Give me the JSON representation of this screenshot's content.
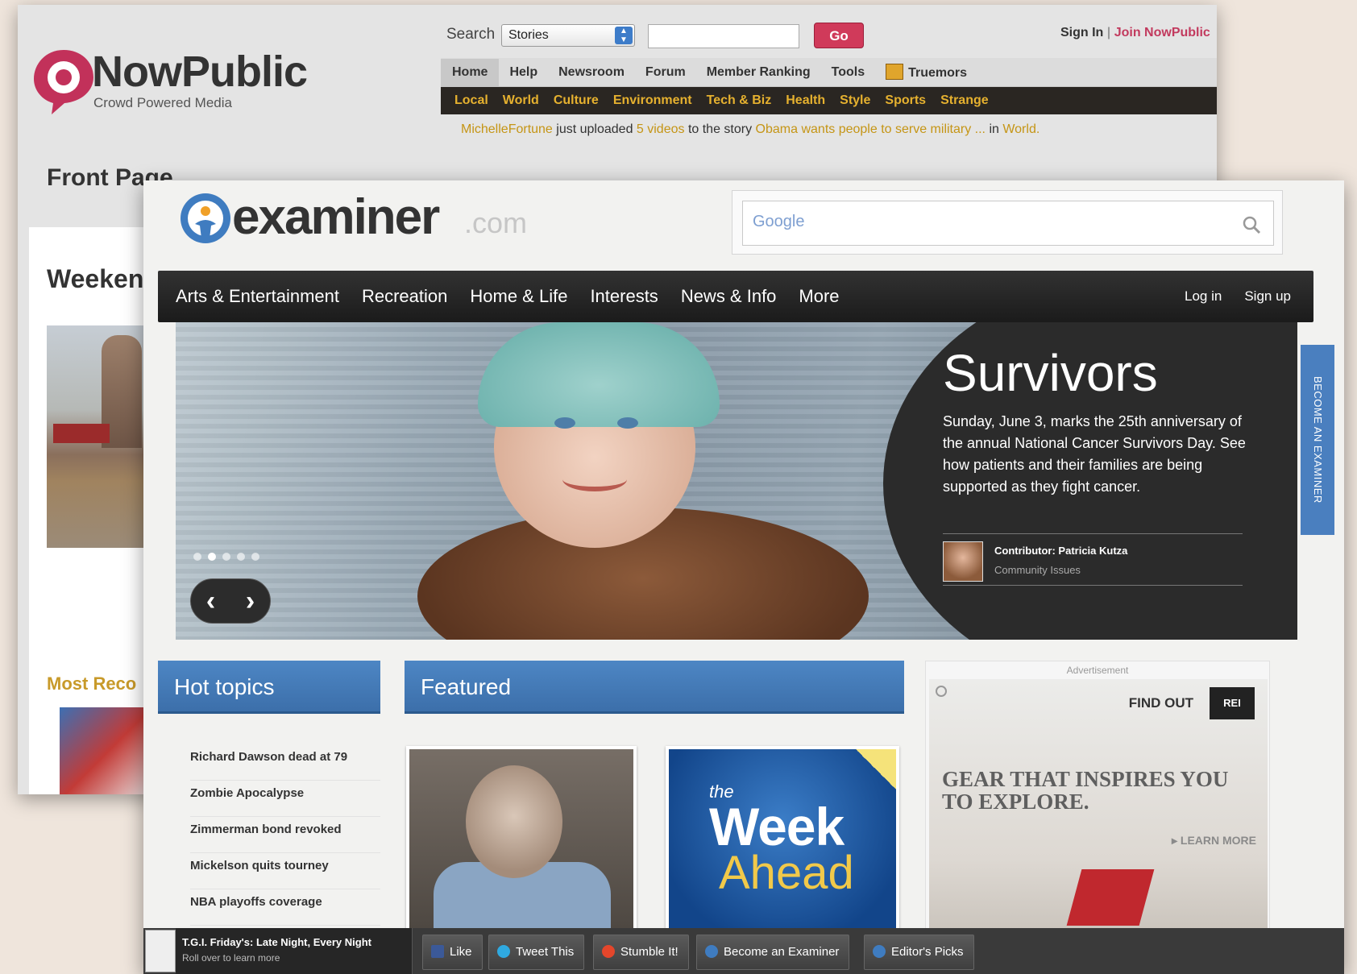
{
  "nowpublic": {
    "brand": "NowPublic",
    "tagline": "Crowd Powered Media",
    "search_label": "Search",
    "search_select": "Stories",
    "go_label": "Go",
    "sign_in": "Sign In",
    "join": "Join NowPublic",
    "nav_main": [
      "Home",
      "Help",
      "Newsroom",
      "Forum",
      "Member Ranking",
      "Tools",
      "Truemors"
    ],
    "nav_sub": [
      "Local",
      "World",
      "Culture",
      "Environment",
      "Tech & Biz",
      "Health",
      "Style",
      "Sports",
      "Strange"
    ],
    "ticker": {
      "user": "MichelleFortune",
      "mid1": " just uploaded ",
      "count": "5 videos",
      "mid2": " to the story ",
      "story": "Obama wants people to serve military ...",
      "mid3": " in ",
      "section": "World."
    },
    "front_page": "Front Page",
    "weekend": "Weeken",
    "most_recent": "Most Reco"
  },
  "examiner": {
    "brand": "examiner",
    "brand_suffix": ".com",
    "google_placeholder": "Google",
    "nav": [
      "Arts & Entertainment",
      "Recreation",
      "Home & Life",
      "Interests",
      "News & Info",
      "More"
    ],
    "login": "Log in",
    "signup": "Sign up",
    "hero": {
      "title": "Survivors",
      "blurb": "Sunday, June 3, marks the 25th anniversary of the annual National Cancer Survivors Day. See how patients and their families are being supported as they fight cancer.",
      "contributor": "Contributor: Patricia Kutza",
      "category": "Community Issues"
    },
    "become_tab": "BECOME AN EXAMINER",
    "hot_topics_title": "Hot topics",
    "hot_topics": [
      "Richard Dawson dead at 79",
      "Zombie Apocalypse",
      "Zimmerman bond revoked",
      "Mickelson quits tourney",
      "NBA playoffs coverage"
    ],
    "featured_title": "Featured",
    "week_ahead": {
      "the": "the",
      "week": "Week",
      "ahead": "Ahead"
    },
    "ad": {
      "label": "Advertisement",
      "find_out": "FIND OUT",
      "logo": "REI",
      "headline": "GEAR THAT INSPIRES YOU TO EXPLORE.",
      "learn_more": "▸ LEARN MORE"
    },
    "bottom": {
      "tgi_title": "T.G.I. Friday's: Late Night, Every Night",
      "tgi_sub": "Roll over to learn more",
      "buttons": [
        "Like",
        "Tweet This",
        "Stumble It!",
        "Become an Examiner",
        "Editor's Picks"
      ]
    }
  },
  "colors": {
    "np_accent": "#d03a5a",
    "np_gold": "#e6b12f",
    "ex_blue": "#4a7fbf",
    "ex_dark": "#222222"
  }
}
